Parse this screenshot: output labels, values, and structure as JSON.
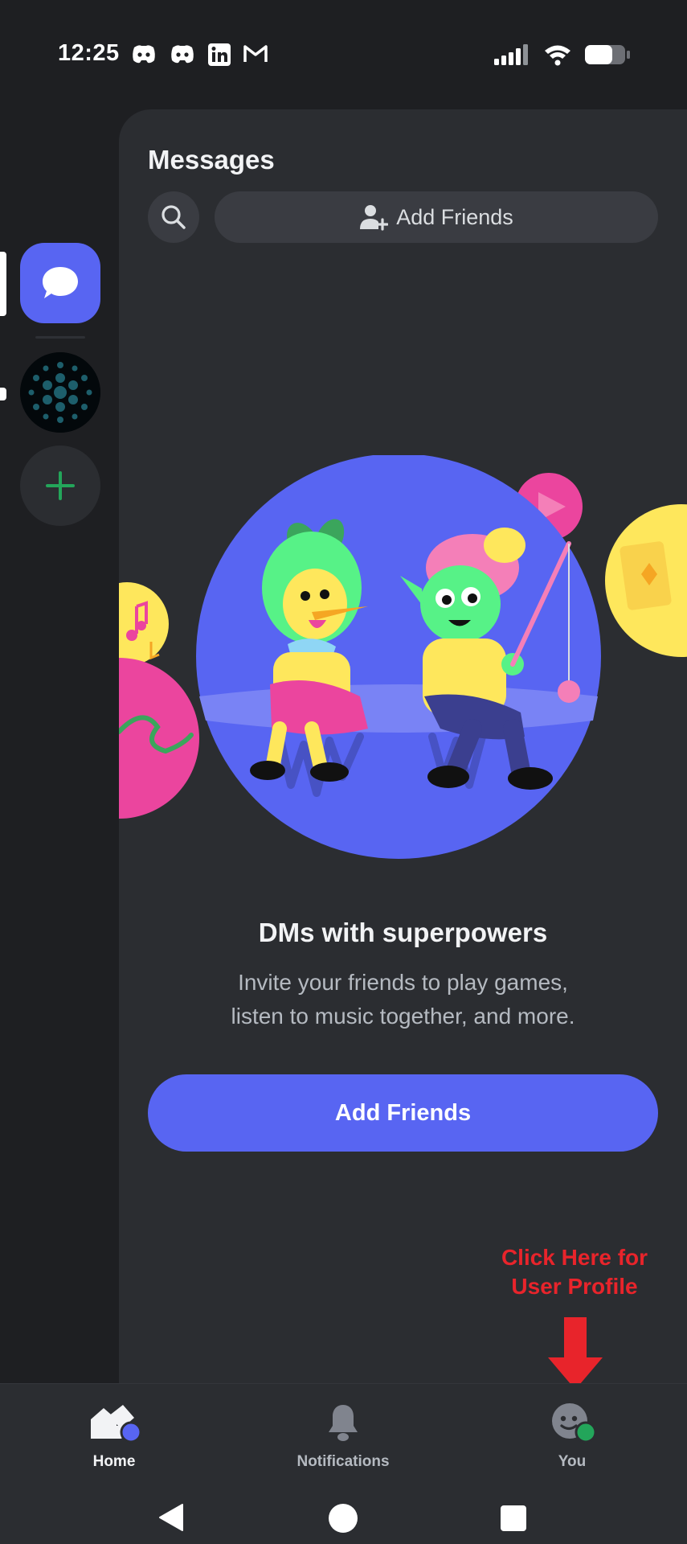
{
  "status_bar": {
    "time": "12:25",
    "left_icons": [
      "discord-icon",
      "discord-icon",
      "linkedin-icon",
      "gmail-icon"
    ],
    "right_icons": [
      "signal-icon",
      "wifi-icon",
      "battery-icon"
    ]
  },
  "rail": {
    "items": [
      {
        "name": "direct-messages",
        "icon": "chat-bubble-icon",
        "selected": true
      },
      {
        "name": "server",
        "icon": "server-avatar"
      },
      {
        "name": "add-server",
        "icon": "plus-icon"
      }
    ]
  },
  "header": {
    "title": "Messages",
    "add_friends_label": "Add Friends"
  },
  "empty_state": {
    "title": "DMs with superpowers",
    "line1": "Invite your friends to play games,",
    "line2": "listen to music together, and more.",
    "button_label": "Add Friends"
  },
  "annotation": {
    "line1": "Click Here for",
    "line2": "User Profile"
  },
  "bottom_nav": {
    "items": [
      {
        "label": "Home",
        "icon": "home-icon",
        "active": true
      },
      {
        "label": "Notifications",
        "icon": "bell-icon",
        "active": false
      },
      {
        "label": "You",
        "icon": "avatar-icon",
        "active": false
      }
    ]
  },
  "colors": {
    "accent": "#5865f2",
    "background": "#1e1f22",
    "panel": "#2b2d31",
    "annotation": "#e8242b",
    "online": "#23a55a"
  }
}
